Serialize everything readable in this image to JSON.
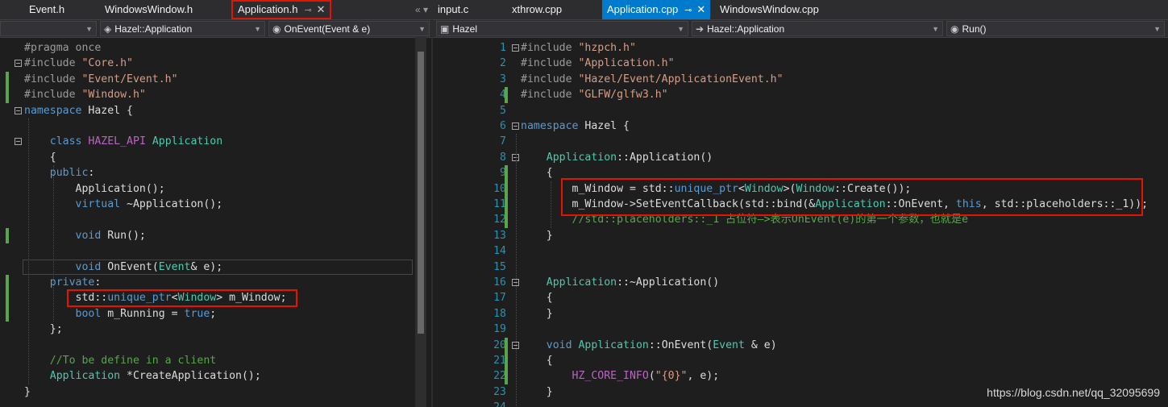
{
  "left": {
    "tabs": [
      {
        "label": "Event.h"
      },
      {
        "label": "WindowsWindow.h"
      },
      {
        "label": "Application.h",
        "pin": "⊸",
        "close": "✕"
      }
    ],
    "tab_tools": "«  ▾",
    "nav": {
      "scope": "Hazel::Application",
      "member": "OnEvent(Event & e)"
    },
    "lines": [
      [
        [
          "pp",
          "#pragma once"
        ]
      ],
      [
        [
          "pp",
          "#include "
        ],
        [
          "str",
          "\"Core.h\""
        ]
      ],
      [
        [
          "pp",
          "#include "
        ],
        [
          "str",
          "\"Event/Event.h\""
        ]
      ],
      [
        [
          "pp",
          "#include "
        ],
        [
          "str",
          "\"Window.h\""
        ]
      ],
      [
        [
          "kw",
          "namespace"
        ],
        [
          "t",
          " Hazel {"
        ]
      ],
      [
        [
          "t",
          ""
        ]
      ],
      [
        [
          "t",
          "    "
        ],
        [
          "kw",
          "class"
        ],
        [
          "t",
          " "
        ],
        [
          "mac",
          "HAZEL_API"
        ],
        [
          "t",
          " "
        ],
        [
          "cls",
          "Application"
        ]
      ],
      [
        [
          "t",
          "    {"
        ]
      ],
      [
        [
          "t",
          "    "
        ],
        [
          "kw",
          "public"
        ],
        [
          "t",
          ":"
        ]
      ],
      [
        [
          "t",
          "        Application();"
        ]
      ],
      [
        [
          "t",
          "        "
        ],
        [
          "kw",
          "virtual"
        ],
        [
          "t",
          " ~Application();"
        ]
      ],
      [
        [
          "t",
          ""
        ]
      ],
      [
        [
          "t",
          "        "
        ],
        [
          "kw",
          "void"
        ],
        [
          "t",
          " Run();"
        ]
      ],
      [
        [
          "t",
          ""
        ]
      ],
      [
        [
          "t",
          "        "
        ],
        [
          "kw",
          "void"
        ],
        [
          "t",
          " OnEvent("
        ],
        [
          "cls",
          "Event"
        ],
        [
          "t",
          "& e);"
        ]
      ],
      [
        [
          "t",
          "    "
        ],
        [
          "kw",
          "private"
        ],
        [
          "t",
          ":"
        ]
      ],
      [
        [
          "t",
          "        std::"
        ],
        [
          "kw",
          "unique_ptr"
        ],
        [
          "t",
          "<"
        ],
        [
          "cls",
          "Window"
        ],
        [
          "t",
          "> m_Window;"
        ]
      ],
      [
        [
          "t",
          "        "
        ],
        [
          "kw",
          "bool"
        ],
        [
          "t",
          " m_Running = "
        ],
        [
          "kw",
          "true"
        ],
        [
          "t",
          ";"
        ]
      ],
      [
        [
          "t",
          "    };"
        ]
      ],
      [
        [
          "t",
          ""
        ]
      ],
      [
        [
          "t",
          "    "
        ],
        [
          "cmt",
          "//To be define in a client"
        ]
      ],
      [
        [
          "t",
          "    "
        ],
        [
          "cls",
          "Application"
        ],
        [
          "t",
          " *CreateApplication();"
        ]
      ],
      [
        [
          "t",
          "}"
        ]
      ]
    ]
  },
  "right": {
    "tabs": [
      {
        "label": "input.c"
      },
      {
        "label": "xthrow.cpp"
      },
      {
        "label": "Application.cpp",
        "pin": "⊸",
        "close": "✕"
      },
      {
        "label": "WindowsWindow.cpp"
      }
    ],
    "nav": {
      "project": "Hazel",
      "scope": "Hazel::Application",
      "member": "Run()"
    },
    "line_numbers": [
      "1",
      "2",
      "3",
      "4",
      "5",
      "6",
      "7",
      "8",
      "9",
      "10",
      "11",
      "12",
      "13",
      "14",
      "15",
      "16",
      "17",
      "18",
      "19",
      "20",
      "21",
      "22",
      "23",
      "24"
    ],
    "lines": [
      [
        [
          "pp",
          "#include "
        ],
        [
          "str",
          "\"hzpch.h\""
        ]
      ],
      [
        [
          "pp",
          "#include "
        ],
        [
          "str",
          "\"Application.h\""
        ]
      ],
      [
        [
          "pp",
          "#include "
        ],
        [
          "str",
          "\"Hazel/Event/ApplicationEvent.h\""
        ]
      ],
      [
        [
          "pp",
          "#include "
        ],
        [
          "str",
          "\"GLFW/glfw3.h\""
        ]
      ],
      [
        [
          "t",
          ""
        ]
      ],
      [
        [
          "kw",
          "namespace"
        ],
        [
          "t",
          " Hazel {"
        ]
      ],
      [
        [
          "t",
          ""
        ]
      ],
      [
        [
          "t",
          "    "
        ],
        [
          "cls",
          "Application"
        ],
        [
          "t",
          "::Application()"
        ]
      ],
      [
        [
          "t",
          "    {"
        ]
      ],
      [
        [
          "t",
          "        m_Window = std::"
        ],
        [
          "kw",
          "unique_ptr"
        ],
        [
          "t",
          "<"
        ],
        [
          "cls",
          "Window"
        ],
        [
          "t",
          ">("
        ],
        [
          "cls",
          "Window"
        ],
        [
          "t",
          "::Create());"
        ]
      ],
      [
        [
          "t",
          "        m_Window->SetEventCallback(std::bind(&"
        ],
        [
          "cls",
          "Application"
        ],
        [
          "t",
          "::OnEvent, "
        ],
        [
          "kw",
          "this"
        ],
        [
          "t",
          ", std::placeholders::_1));"
        ]
      ],
      [
        [
          "t",
          "        "
        ],
        [
          "cmt",
          "//std::placeholders::_1 占位符—>表示OnEvent(e)的第一个参数，也就是e"
        ]
      ],
      [
        [
          "t",
          "    }"
        ]
      ],
      [
        [
          "t",
          ""
        ]
      ],
      [
        [
          "t",
          ""
        ]
      ],
      [
        [
          "t",
          "    "
        ],
        [
          "cls",
          "Application"
        ],
        [
          "t",
          "::~Application()"
        ]
      ],
      [
        [
          "t",
          "    {"
        ]
      ],
      [
        [
          "t",
          "    }"
        ]
      ],
      [
        [
          "t",
          ""
        ]
      ],
      [
        [
          "t",
          "    "
        ],
        [
          "kw",
          "void"
        ],
        [
          "t",
          " "
        ],
        [
          "cls",
          "Application"
        ],
        [
          "t",
          "::OnEvent("
        ],
        [
          "cls",
          "Event"
        ],
        [
          "t",
          " & e)"
        ]
      ],
      [
        [
          "t",
          "    {"
        ]
      ],
      [
        [
          "t",
          "        "
        ],
        [
          "mac",
          "HZ_CORE_INFO"
        ],
        [
          "t",
          "("
        ],
        [
          "str",
          "\"{0}\""
        ],
        [
          "t",
          ", e);"
        ]
      ],
      [
        [
          "t",
          "    }"
        ]
      ],
      [
        [
          "t",
          ""
        ]
      ]
    ]
  },
  "watermark": "https://blog.csdn.net/qq_32095699",
  "colors": {
    "keyword": "#569cd6",
    "string": "#d69d85",
    "type": "#4ec9b0",
    "macro": "#bd63c5",
    "comment": "#57a64a",
    "line_number": "#2b91af",
    "accent": "#007acc",
    "highlight_box": "#e51400"
  }
}
